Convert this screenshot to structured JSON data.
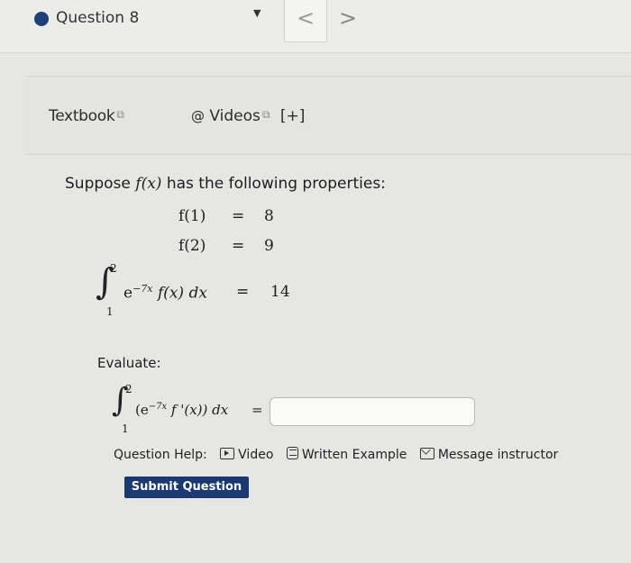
{
  "header": {
    "question_title": "Question 8",
    "nav_dropdown_icon": "▼",
    "nav_prev": "<",
    "nav_next": ">"
  },
  "resources": {
    "textbook_label": "Textbook",
    "videos_label": "Videos",
    "expand_label": "[+]",
    "external_link_icon": "⧉"
  },
  "problem": {
    "intro_suppose": "Suppose",
    "intro_rest": "has the following properties:",
    "f_of_x": "f(x)",
    "eq": "=",
    "prop1_lhs": "f(1)",
    "prop1_rhs": "8",
    "prop2_lhs": "f(2)",
    "prop2_rhs": "9",
    "integral_upper": "2",
    "integral_lower": "1",
    "integral_base": "e",
    "integral_exp": "−7x",
    "integral_body": "f(x) dx",
    "integral_rhs": "14"
  },
  "evaluate": {
    "label": "Evaluate:",
    "upper": "2",
    "lower": "1",
    "open": "(e",
    "exp": "−7x",
    "body": "f '(x)) dx",
    "eq": "=",
    "answer_value": ""
  },
  "help": {
    "label": "Question Help:",
    "video": "Video",
    "written_example": "Written Example",
    "message_instructor": "Message instructor"
  },
  "submit_label": "Submit Question"
}
